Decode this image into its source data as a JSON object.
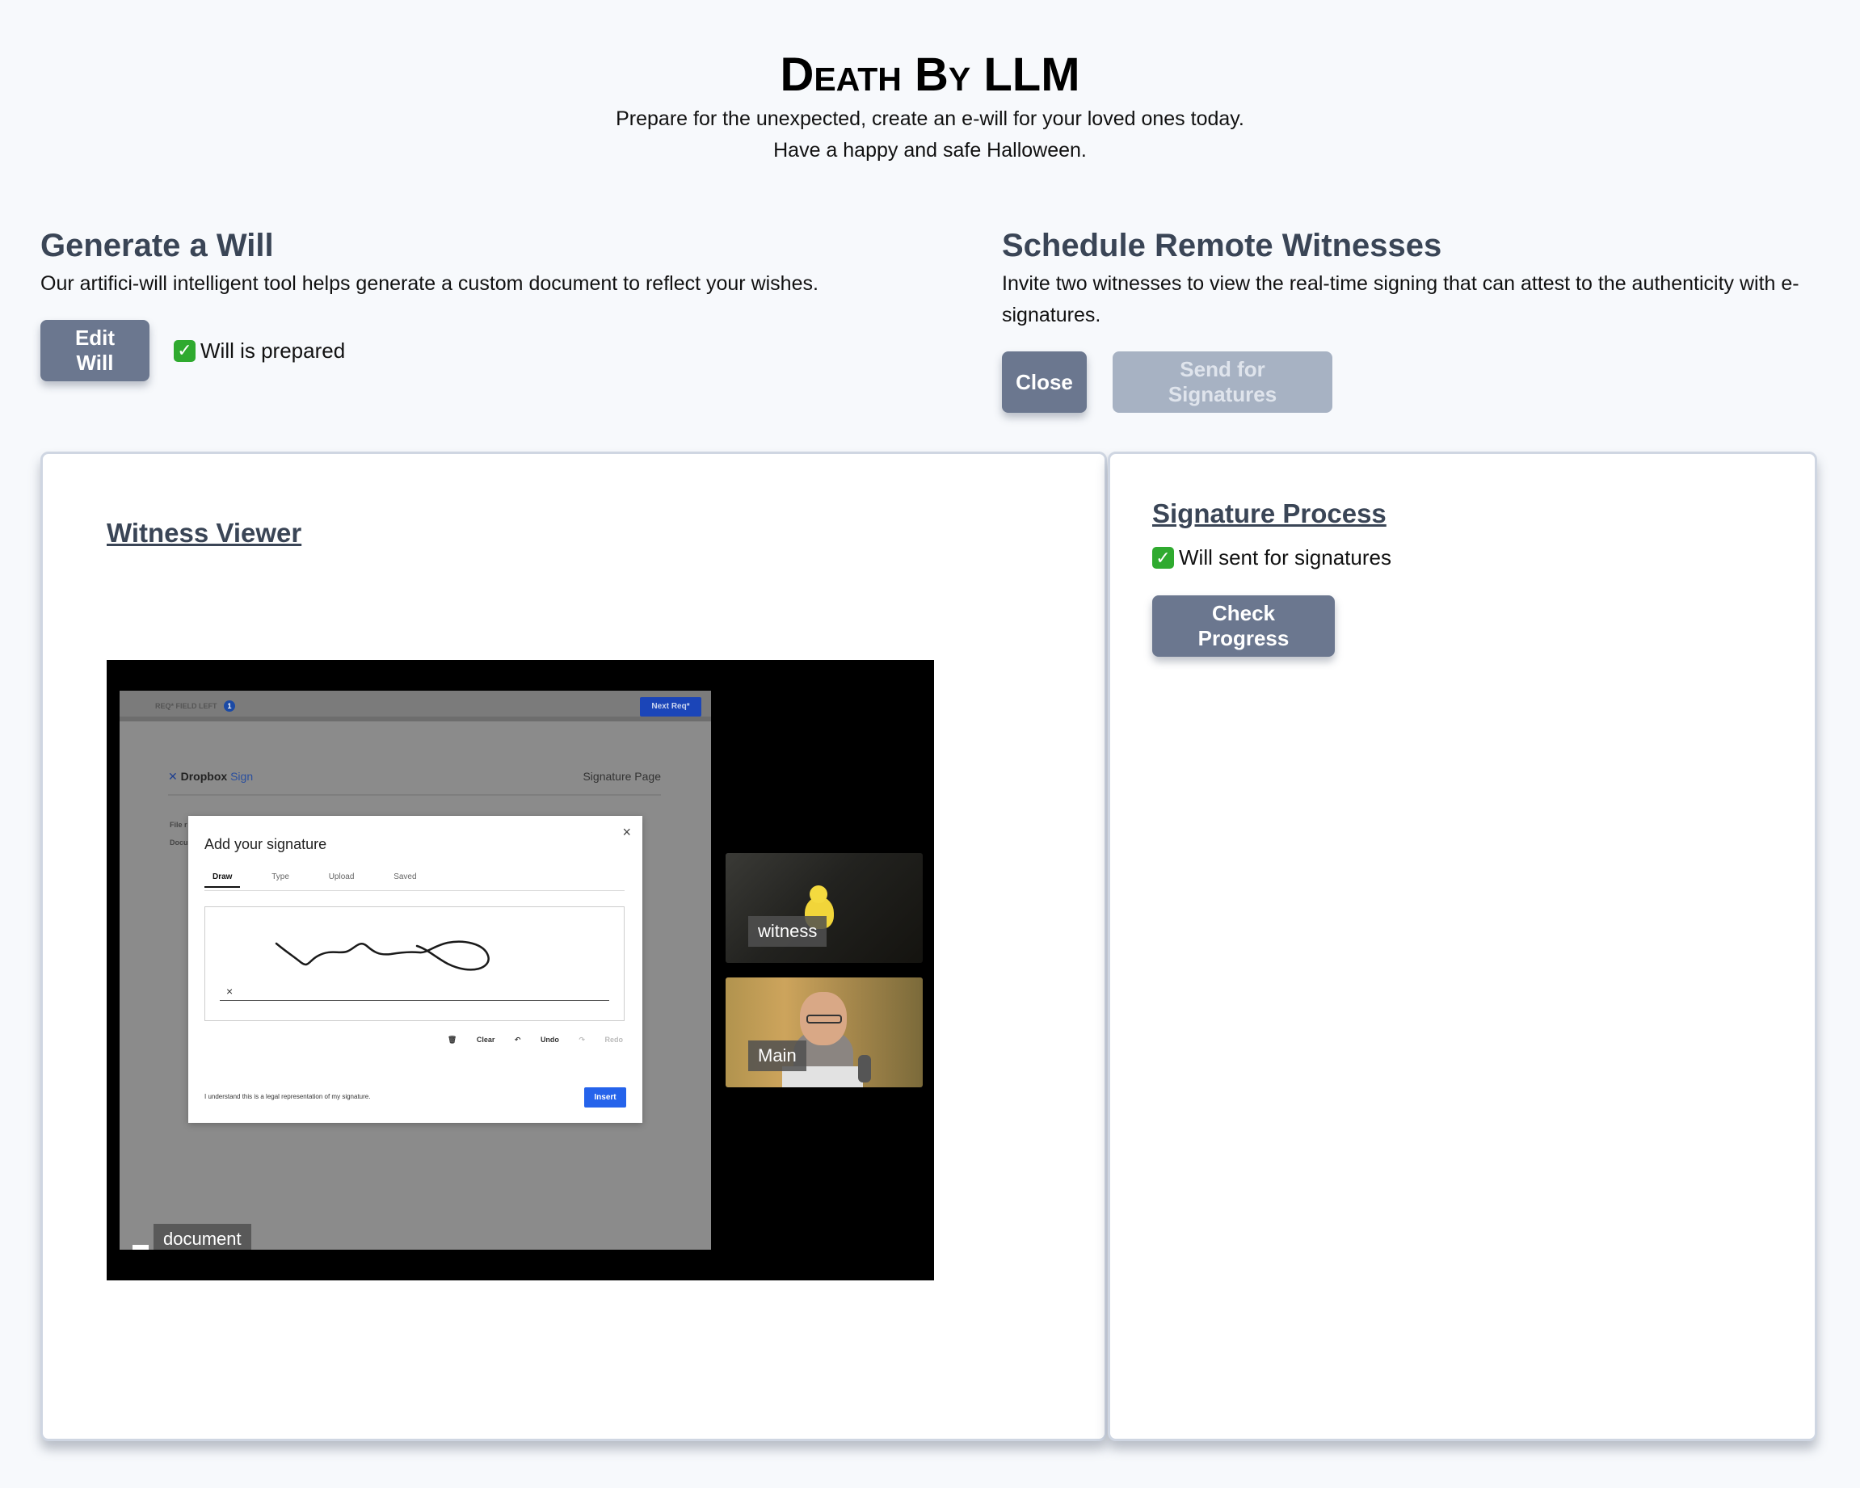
{
  "header": {
    "title": "Death By LLM",
    "subtitle_line1": "Prepare for the unexpected, create an e-will for your loved ones today.",
    "subtitle_line2": "Have a happy and safe Halloween."
  },
  "generate": {
    "heading": "Generate a Will",
    "description": "Our artifici-will intelligent tool helps generate a custom document to reflect your wishes.",
    "edit_button": "Edit Will",
    "status": "Will is prepared",
    "status_icon": "check-mark-icon"
  },
  "schedule": {
    "heading": "Schedule Remote Witnesses",
    "description": "Invite two witnesses to view the real-time signing that can attest to the authenticity with e-signatures.",
    "close_button": "Close",
    "send_button": "Send for Signatures"
  },
  "witness_viewer": {
    "heading": "Witness Viewer",
    "document_label": "document",
    "tiles": [
      {
        "label": "witness"
      },
      {
        "label": "Main"
      }
    ],
    "shared_doc": {
      "fields_left": "REQ* FIELD LEFT",
      "fields_count": "1",
      "next_button": "Next Req*",
      "logo": "Dropbox",
      "logo_suffix": "Sign",
      "page_label": "Signature Page",
      "mini_lines": [
        "File r",
        "Docu"
      ],
      "modal": {
        "title": "Add your signature",
        "tabs": [
          "Draw",
          "Type",
          "Upload",
          "Saved"
        ],
        "active_tab": "Draw",
        "actions": [
          "Clear",
          "Undo",
          "Redo"
        ],
        "legal": "I understand this is a legal representation of my signature.",
        "insert_button": "Insert"
      }
    }
  },
  "signature_process": {
    "heading": "Signature Process",
    "status": "Will sent for signatures",
    "status_icon": "check-mark-icon",
    "check_button": "Check Progress"
  },
  "colors": {
    "button": "#6b778f",
    "button_disabled": "#a7b2c3",
    "heading": "#3a4556",
    "check_green": "#2faa2f",
    "insert_blue": "#2563eb"
  }
}
